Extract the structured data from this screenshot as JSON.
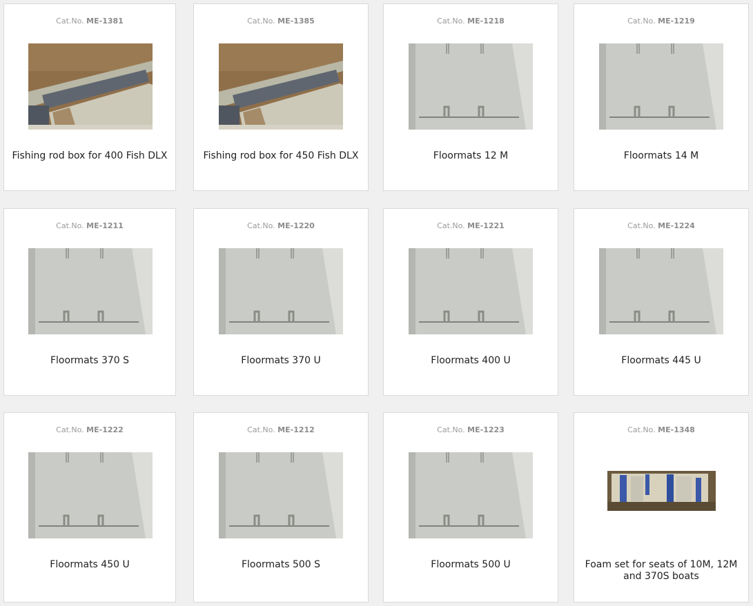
{
  "catno_prefix": "Cat.No.",
  "products": [
    {
      "catno": "ME-1381",
      "title": "Fishing rod box for 400 Fish DLX",
      "image": "rod-box-photo"
    },
    {
      "catno": "ME-1385",
      "title": "Fishing rod box for 450 Fish DLX",
      "image": "rod-box-photo"
    },
    {
      "catno": "ME-1218",
      "title": "Floormats 12 M",
      "image": "floormat-photo"
    },
    {
      "catno": "ME-1219",
      "title": "Floormats 14 M",
      "image": "floormat-photo"
    },
    {
      "catno": "ME-1211",
      "title": "Floormats 370 S",
      "image": "floormat-photo"
    },
    {
      "catno": "ME-1220",
      "title": "Floormats 370 U",
      "image": "floormat-photo"
    },
    {
      "catno": "ME-1221",
      "title": "Floormats 400 U",
      "image": "floormat-photo"
    },
    {
      "catno": "ME-1224",
      "title": "Floormats 445 U",
      "image": "floormat-photo"
    },
    {
      "catno": "ME-1222",
      "title": "Floormats 450 U",
      "image": "floormat-photo"
    },
    {
      "catno": "ME-1212",
      "title": "Floormats 500 S",
      "image": "floormat-photo"
    },
    {
      "catno": "ME-1223",
      "title": "Floormats 500 U",
      "image": "floormat-photo"
    },
    {
      "catno": "ME-1348",
      "title": "Foam set for seats of 10M, 12M and 370S boats",
      "image": "foam-set-photo"
    }
  ]
}
